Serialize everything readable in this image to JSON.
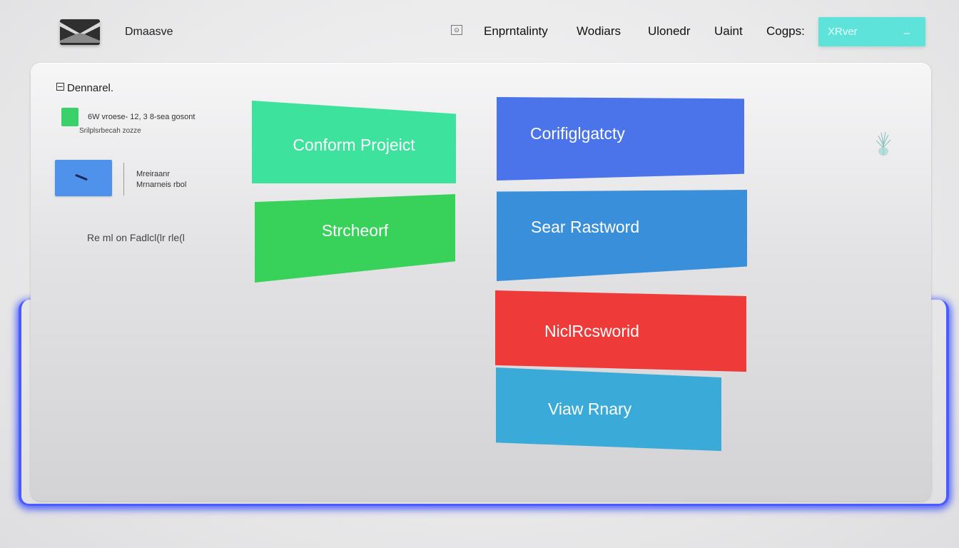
{
  "header": {
    "app_title": "Dmaasve",
    "nav": [
      "Enprntalinty",
      "Wodiars",
      "Ulonedr",
      "Uaint",
      "Cogps:"
    ],
    "action_button": {
      "label": "XRver",
      "suffix": "–"
    },
    "logo_icon": "envelope-logo-icon",
    "search_icon": "search-icon"
  },
  "sidebar": {
    "title": "Dennarel.",
    "item1": {
      "line1": "6W vroese- 12, 3 8-sea gosont",
      "line2": "Srilplsrbecah zozze",
      "color": "#3ad16b"
    },
    "item2": {
      "line1": "Mreiraanr",
      "line2": "Mrnarneis rbol",
      "color": "#4f92ec"
    },
    "link": "Re ml on Fadlcl(lr rle(l"
  },
  "actions": {
    "conform": {
      "label": "Conform Projeict",
      "color": "#3de39d"
    },
    "structure": {
      "label": "Strcheorf",
      "color": "#38d25a"
    },
    "config": {
      "label": "Corifiglgatcty",
      "color": "#4b74ea"
    },
    "search": {
      "label": "Sear Rastword",
      "color": "#3a8fda"
    },
    "nicl": {
      "label": "NiclRcsworid",
      "color": "#ef3a3a"
    },
    "view": {
      "label": "Viaw Rnary",
      "color": "#3aaad8"
    }
  },
  "accent_glow": "#4a5cff"
}
